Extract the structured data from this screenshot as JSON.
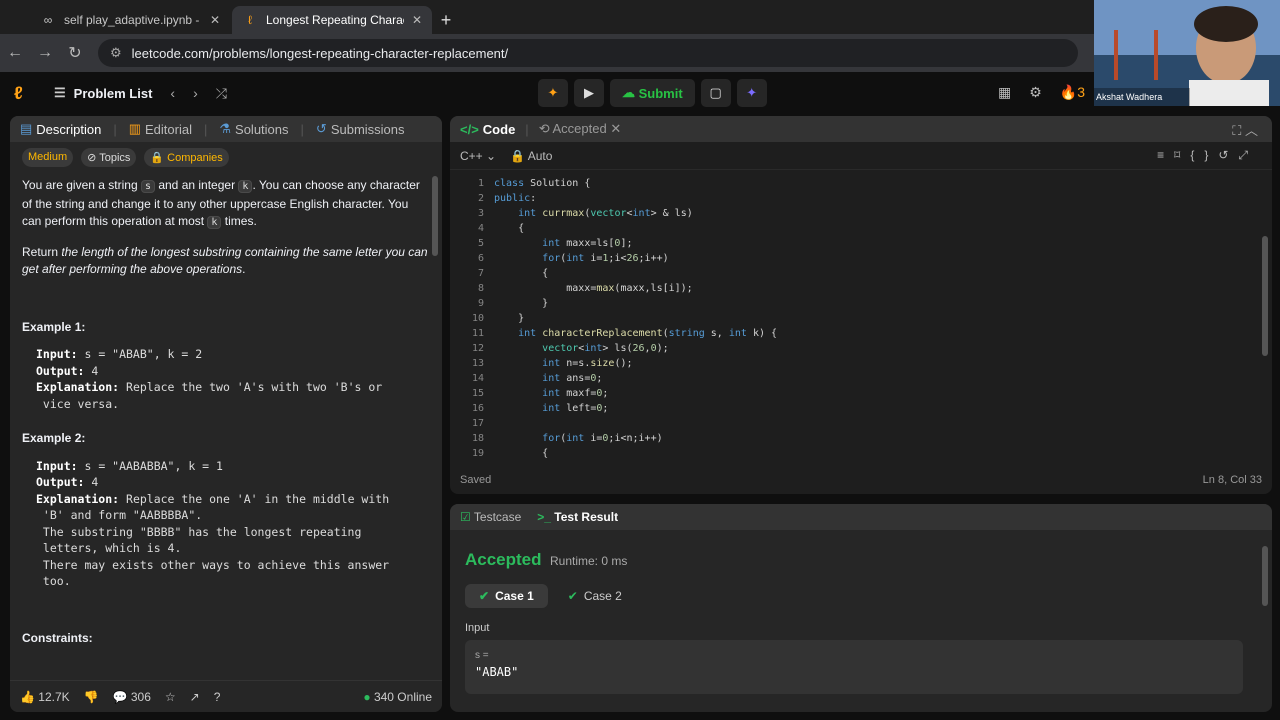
{
  "browser": {
    "tabs": [
      {
        "icon": "colab-icon",
        "title": "self play_adaptive.ipynb - Colab"
      },
      {
        "icon": "leetcode-icon",
        "title": "Longest Repeating Character Re"
      }
    ],
    "url": "leetcode.com/problems/longest-repeating-character-replacement/"
  },
  "nav": {
    "problem_list": "Problem List",
    "submit": "Submit",
    "streak": "3"
  },
  "webcam": {
    "name": "Akshat Wadhera"
  },
  "left": {
    "tabs": [
      "Description",
      "Editorial",
      "Solutions",
      "Submissions"
    ],
    "badges": [
      "Medium",
      "Topics",
      "Companies"
    ],
    "desc_p1": [
      "You are given a string ",
      "s",
      " and an integer ",
      "k",
      ". You can choose any character of the string and change it to any other uppercase English character. You can perform this operation at most ",
      "k",
      " times."
    ],
    "desc_p2": [
      "Return ",
      "the length of the longest substring containing the same letter you can get after performing the above operations",
      "."
    ],
    "ex1_title": "Example 1:",
    "ex1": [
      [
        "Input:",
        " s = \"ABAB\", k = 2"
      ],
      [
        "Output:",
        " 4"
      ],
      [
        "Explanation:",
        " Replace the two 'A's with two 'B's or"
      ],
      [
        "",
        " vice versa."
      ]
    ],
    "ex2_title": "Example 2:",
    "ex2": [
      [
        "Input:",
        " s = \"AABABBA\", k = 1"
      ],
      [
        "Output:",
        " 4"
      ],
      [
        "Explanation:",
        " Replace the one 'A' in the middle with"
      ],
      [
        "",
        " 'B' and form \"AABBBBA\"."
      ],
      [
        "",
        " The substring \"BBBB\" has the longest repeating"
      ],
      [
        "",
        " letters, which is 4."
      ],
      [
        "",
        " There may exists other ways to achieve this answer"
      ],
      [
        "",
        " too."
      ]
    ],
    "constraints": "Constraints:",
    "likes": "12.7K",
    "comments": "306",
    "online": "340 Online"
  },
  "code": {
    "tab": "Code",
    "accepted": "Accepted",
    "lang": "C++",
    "auto": "Auto",
    "saved": "Saved",
    "cursor": "Ln 8, Col 33",
    "lines": [
      "class Solution {",
      "public:",
      "    int currmax(vector<int> & ls)",
      "    {",
      "        int maxx=ls[0];",
      "        for(int i=1;i<26;i++)",
      "        {",
      "            maxx=max(maxx,ls[i]);",
      "        }",
      "    }",
      "    int characterReplacement(string s, int k) {",
      "        vector<int> ls(26,0);",
      "        int n=s.size();",
      "        int ans=0;",
      "        int maxf=0;",
      "        int left=0;",
      "",
      "        for(int i=0;i<n;i++)",
      "        {"
    ]
  },
  "result": {
    "testcase": "Testcase",
    "test_result": "Test Result",
    "status": "Accepted",
    "runtime": "Runtime: 0 ms",
    "cases": [
      "Case 1",
      "Case 2"
    ],
    "input_label": "Input",
    "var": "s =",
    "value": "\"ABAB\""
  },
  "colors": {
    "accent": "#ffa116",
    "accepted": "#2cbb5d",
    "submit": "#28c244"
  }
}
